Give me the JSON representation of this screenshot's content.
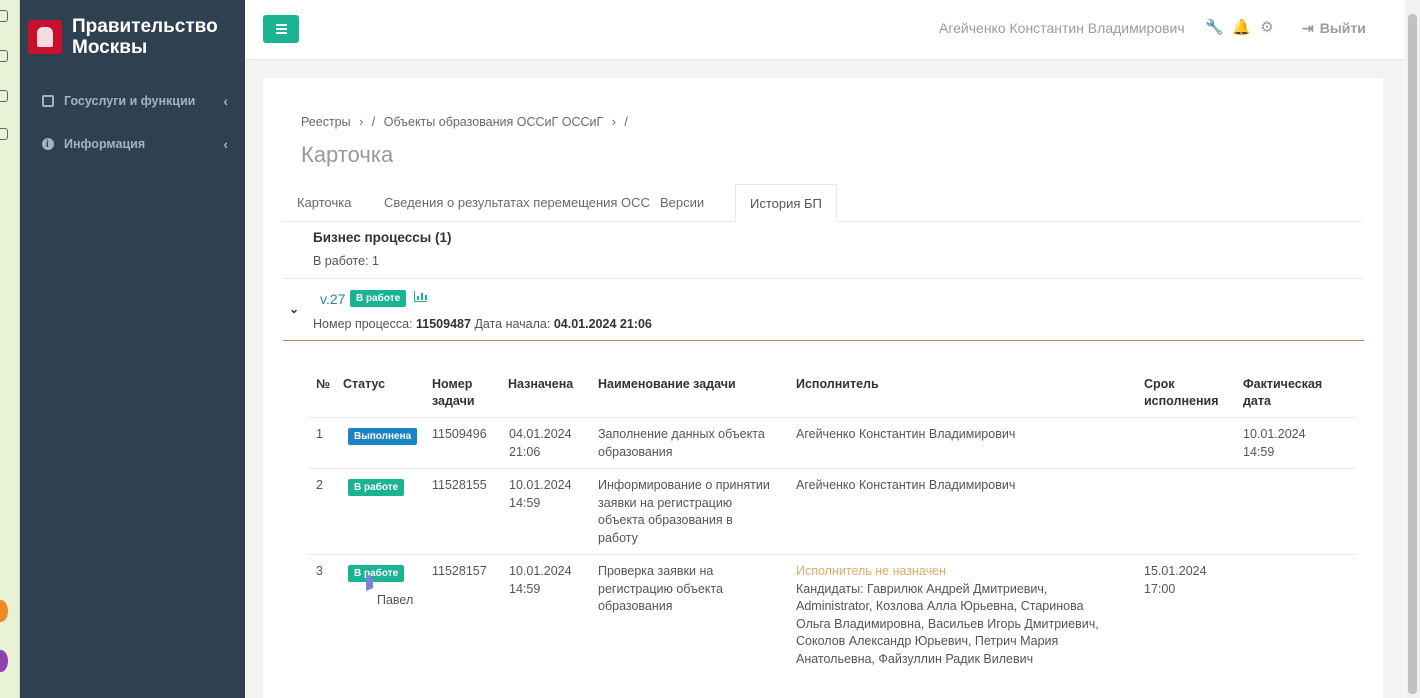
{
  "brand": {
    "line1": "Правительство",
    "line2": "Москвы"
  },
  "sidebar": {
    "items": [
      {
        "label": "Госуслуги и функции",
        "icon": "edit-icon"
      },
      {
        "label": "Информация",
        "icon": "info-icon"
      }
    ],
    "chevron": "‹"
  },
  "header": {
    "user": "Агейченко Константин Владимирович",
    "logout": "Выйти",
    "icons": [
      "wrench-icon",
      "bell-icon",
      "gears-icon",
      "sign-out-icon"
    ]
  },
  "breadcrumb": {
    "items": [
      "Реестры",
      "›",
      "/",
      "Объекты образования ОССиГ ОССиГ",
      "›",
      "/"
    ]
  },
  "page_title": "Карточка",
  "tabs": [
    {
      "label": "Карточка",
      "active": false
    },
    {
      "label": "Сведения о результатах перемещения ОСС",
      "active": false
    },
    {
      "label": "Версии",
      "active": false
    },
    {
      "label": "История БП",
      "active": true
    }
  ],
  "bp": {
    "title": "Бизнес процессы (1)",
    "in_work_label": "В работе:",
    "in_work_count": "1"
  },
  "process": {
    "caret": "⌄",
    "version": "v.27",
    "status": "В работе",
    "number_label": "Номер процесса:",
    "number": "11509487",
    "start_label": "Дата начала:",
    "start": "04.01.2024 21:06"
  },
  "table": {
    "headers": {
      "num": "№",
      "status": "Статус",
      "task_num_1": "Номер",
      "task_num_2": "задачи",
      "assigned": "Назначена",
      "task_name": "Наименование задачи",
      "executor": "Исполнитель",
      "deadline_1": "Срок",
      "deadline_2": "исполнения",
      "actual_1": "Фактическая",
      "actual_2": "дата"
    },
    "rows": [
      {
        "num": "1",
        "status": "Выполнена",
        "status_color": "#1c84c6",
        "task_num": "11509496",
        "assigned_1": "04.01.2024",
        "assigned_2": "21:06",
        "name_lines": [
          "Заполнение данных объекта",
          "образования"
        ],
        "executor": "Агейченко Константин Владимирович",
        "deadline_1": "",
        "deadline_2": "",
        "actual_1": "10.01.2024",
        "actual_2": "14:59"
      },
      {
        "num": "2",
        "status": "В работе",
        "status_color": "#1ab394",
        "task_num": "11528155",
        "assigned_1": "10.01.2024",
        "assigned_2": "14:59",
        "name_lines": [
          "Информирование о принятии",
          "заявки на регистрацию",
          "объекта образования в",
          "работу"
        ],
        "executor": "Агейченко Константин Владимирович",
        "deadline_1": "",
        "deadline_2": "",
        "actual_1": "",
        "actual_2": ""
      },
      {
        "num": "3",
        "status": "В работе",
        "status_color": "#1ab394",
        "task_num": "11528157",
        "assigned_1": "10.01.2024",
        "assigned_2": "14:59",
        "name_lines": [
          "Проверка заявки на",
          "регистрацию объекта",
          "образования"
        ],
        "executor_warning": "Исполнитель не назначен",
        "executor_lines": [
          "Кандидаты: Гаврилюк Андрей Дмитриевич,",
          "Administrator, Козлова Алла Юрьевна, Старинова",
          "Ольга Владимировна, Васильев Игорь Дмитриевич,",
          "Соколов Александр Юрьевич, Петрич Мария",
          "Анатольевна, Файзуллин Радик Вилевич"
        ],
        "deadline_1": "15.01.2024",
        "deadline_2": "17:00",
        "actual_1": "",
        "actual_2": ""
      }
    ]
  },
  "tooltip": "Павел",
  "colors": {
    "sidebar": "#2f4050",
    "accent": "#1ab394",
    "done": "#1c84c6",
    "warning": "#e7a96a"
  }
}
